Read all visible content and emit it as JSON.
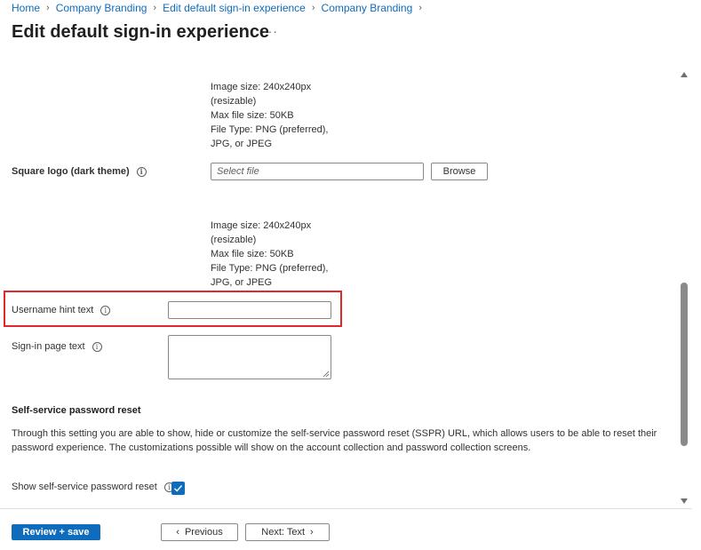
{
  "breadcrumb": {
    "items": [
      "Home",
      "Company Branding",
      "Edit default sign-in experience",
      "Company Branding"
    ],
    "separator": "›"
  },
  "header": {
    "title": "Edit default sign-in experience",
    "more_label": "···"
  },
  "form": {
    "image_info_1": [
      "Image size: 240x240px",
      "(resizable)",
      "Max file size: 50KB",
      "File Type: PNG (preferred),",
      "JPG, or JPEG"
    ],
    "square_logo_dark": {
      "label": "Square logo (dark theme)",
      "placeholder": "Select file",
      "browse_label": "Browse"
    },
    "image_info_2": [
      "Image size: 240x240px",
      "(resizable)",
      "Max file size: 50KB",
      "File Type: PNG (preferred),",
      "JPG, or JPEG"
    ],
    "username_hint": {
      "label": "Username hint text",
      "value": ""
    },
    "signin_page_text": {
      "label": "Sign-in page text",
      "value": ""
    },
    "sspr": {
      "title": "Self-service password reset",
      "description": "Through this setting you are able to show, hide or customize the self-service password reset (SSPR) URL, which allows users to be able to reset their password experience. The customizations possible will show on the account collection and password collection screens.",
      "show_label": "Show self-service password reset",
      "show_checked": true
    },
    "info_icon_glyph": "i"
  },
  "footer": {
    "review_save": "Review + save",
    "previous": "Previous",
    "next": "Next: Text"
  },
  "colors": {
    "accent": "#0f6cbd",
    "highlight": "#e3262c"
  }
}
